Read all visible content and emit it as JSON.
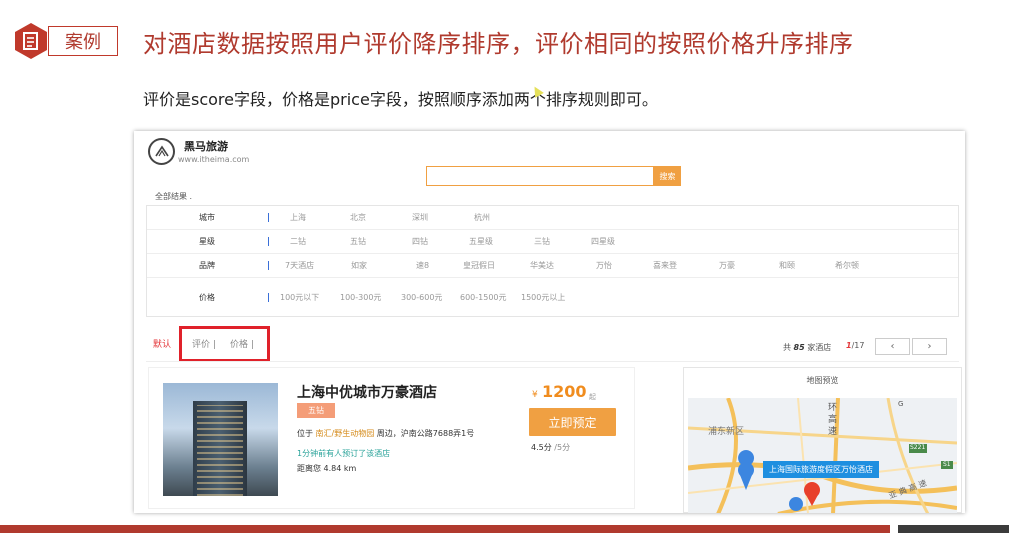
{
  "slide": {
    "tag": "案例",
    "title": "对酒店数据按照用户评价降序排序，评价相同的按照价格升序排序",
    "subtitle": "评价是score字段，价格是price字段，按照顺序添加两个排序规则即可。"
  },
  "site": {
    "logo_name": "黑马旅游",
    "logo_url": "www.itheima.com",
    "search_placeholder": "",
    "search_button": "搜索",
    "all_results": "全部结果 ."
  },
  "filters": [
    {
      "key": "城市",
      "options": [
        "上海",
        "北京",
        "深圳",
        "杭州"
      ]
    },
    {
      "key": "星级",
      "options": [
        "二钻",
        "五钻",
        "四钻",
        "五星级",
        "三钻",
        "四星级"
      ]
    },
    {
      "key": "品牌",
      "options": [
        "7天酒店",
        "如家",
        "速8",
        "皇冠假日",
        "华美达",
        "万怡",
        "喜来登",
        "万豪",
        "和颐",
        "希尔顿"
      ]
    },
    {
      "key": "价格",
      "options": [
        "100元以下",
        "100-300元",
        "300-600元",
        "600-1500元",
        "1500元以上"
      ]
    }
  ],
  "sort": {
    "default": "默认",
    "score": "评价 |",
    "price": "价格 |"
  },
  "results": {
    "prefix": "共",
    "count": "85",
    "suffix": "家酒店",
    "page_current": "1",
    "page_total": "/17",
    "prev": "‹",
    "next": "›"
  },
  "hotel": {
    "name": "上海中优城市万豪酒店",
    "star": "五钻",
    "addr_prefix": "位于",
    "addr_highlight": "南汇/野生动物园",
    "addr_suffix": "周边，沪南公路7688弄1号",
    "recent": "1分钟前有人预订了该酒店",
    "distance": "距离您 4.84 km",
    "price_symbol": "¥",
    "price": "1200",
    "price_unit": "起",
    "book_button": "立即预定",
    "score": "4.5分",
    "score_max": "/5分"
  },
  "map": {
    "title": "地图预览",
    "district": "浦东新区",
    "road1": "环",
    "road2": "高",
    "road3": "速",
    "road4": "亚 典 高 速",
    "highway_s221": "S221",
    "highway_s1": "S1",
    "highway_g": "G",
    "popup": "上海国际旅游度假区万怡酒店"
  },
  "colors": {
    "brand_red": "#b03a2e",
    "orange": "#f0a042",
    "highlight_red": "#e0212a",
    "map_blue": "#1e8fe0"
  }
}
